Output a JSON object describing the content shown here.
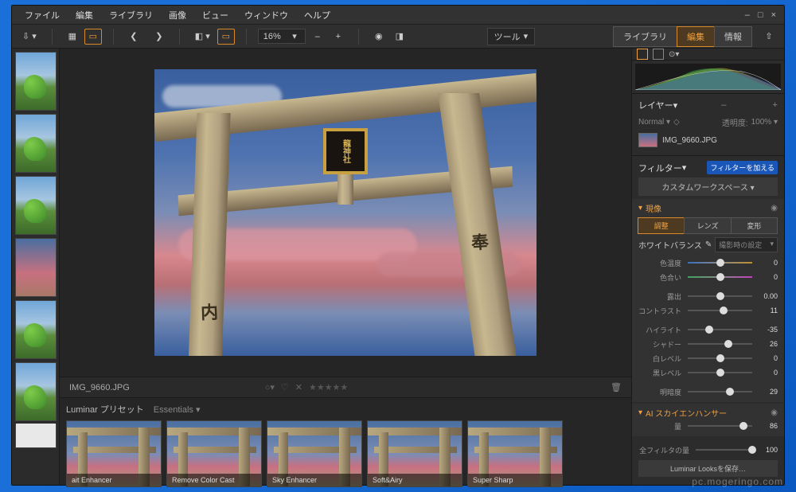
{
  "menu": {
    "items": [
      "ファイル",
      "編集",
      "ライブラリ",
      "画像",
      "ビュー",
      "ウィンドウ",
      "ヘルプ"
    ]
  },
  "win_controls": {
    "min": "–",
    "max": "□",
    "close": "×"
  },
  "toolbar": {
    "zoom": "16%",
    "tool": "ツール"
  },
  "mode_tabs": {
    "library": "ライブラリ",
    "edit": "編集",
    "info": "情報"
  },
  "info_bar": {
    "filename": "IMG_9660.JPG"
  },
  "plaque": "龍神社",
  "kanji1": "奉",
  "kanji2": "内",
  "presets": {
    "header": "Luminar プリセット",
    "category": "Essentials",
    "items": [
      "ait Enhancer",
      "Remove Color Cast",
      "Sky Enhancer",
      "Soft&Airy",
      "Super Sharp"
    ]
  },
  "panel": {
    "layers": "レイヤー",
    "blend": "Normal",
    "opacity_label": "透明度:",
    "opacity_value": "100%",
    "layer_name": "IMG_9660.JPG",
    "filters": "フィルター",
    "add_filter": "フィルターを加える",
    "workspace": "カスタムワークスペース",
    "develop": "現像",
    "tabs": {
      "adjust": "調整",
      "lens": "レンズ",
      "distort": "変形"
    },
    "wb_label": "ホワイトバランス",
    "wb_mode": "撮影時の設定",
    "sliders": {
      "temp": {
        "label": "色温度",
        "value": "0",
        "pos": 50
      },
      "tint": {
        "label": "色合い",
        "value": "0",
        "pos": 50
      },
      "exposure": {
        "label": "露出",
        "value": "0.00",
        "pos": 50
      },
      "contrast": {
        "label": "コントラスト",
        "value": "11",
        "pos": 55
      },
      "highlights": {
        "label": "ハイライト",
        "value": "-35",
        "pos": 33
      },
      "shadows": {
        "label": "シャドー",
        "value": "26",
        "pos": 63
      },
      "whites": {
        "label": "白レベル",
        "value": "0",
        "pos": 50
      },
      "blacks": {
        "label": "黒レベル",
        "value": "0",
        "pos": 50
      },
      "clarity": {
        "label": "明暗度",
        "value": "29",
        "pos": 65
      },
      "sky": {
        "label": "量",
        "value": "86",
        "pos": 86
      },
      "global": {
        "label": "全フィルタの量",
        "value": "100",
        "pos": 100
      }
    },
    "sky_enhancer": "AI スカイエンハンサー",
    "looks_save": "Luminar Looksを保存…"
  },
  "watermark": "pc.mogeringo.com"
}
